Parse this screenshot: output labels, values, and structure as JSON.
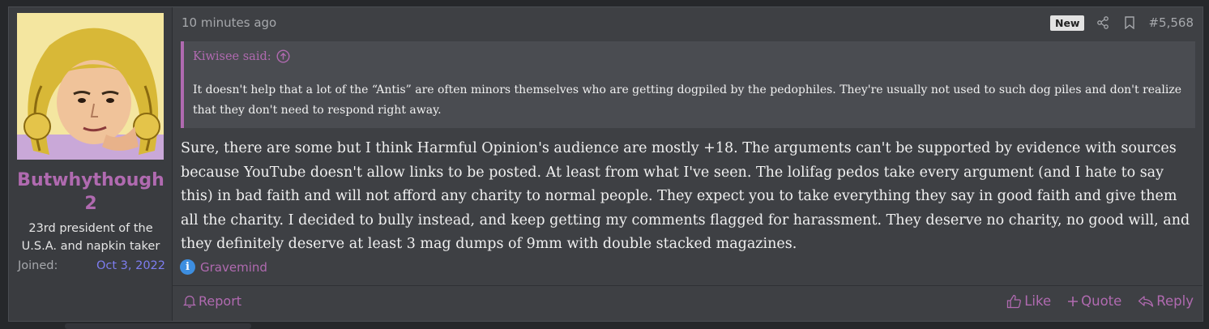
{
  "user": {
    "username": "Butwhythough 2",
    "title": "23rd president of the U.S.A. and napkin taker",
    "joined_label": "Joined:",
    "joined_value": "Oct 3, 2022"
  },
  "post": {
    "timestamp": "10 minutes ago",
    "badge": "New",
    "number": "#5,568",
    "quote": {
      "author": "Kiwisee said:",
      "text": "It doesn't help that a lot of the “Antis” are often minors themselves who are getting dogpiled by the pedophiles. They're usually not used to such dog piles and don't realize that they don't need to respond right away."
    },
    "body": "Sure, there are some but I think Harmful Opinion's audience are mostly +18. The arguments can't be supported by evidence with sources because YouTube doesn't allow links to be posted. At least from what I've seen. The lolifag pedos take every argument (and I hate to say this) in bad faith and will not afford any charity to normal people. They expect you to take everything they say in good faith and give them all the charity. I decided to bully instead, and keep getting my comments flagged for harassment. They deserve no charity, no good will, and they definitely deserve at least 3 mag dumps of 9mm with double stacked magazines.",
    "reaction": {
      "icon": "info-icon",
      "user": "Gravemind"
    }
  },
  "footer": {
    "report_label": "Report",
    "like_label": "Like",
    "quote_label": "Quote",
    "reply_label": "Reply"
  },
  "colors": {
    "accent": "#b06ab0",
    "link_blue": "#7d7df0",
    "background": "#3e4044",
    "info_blue": "#3d8ee0"
  }
}
